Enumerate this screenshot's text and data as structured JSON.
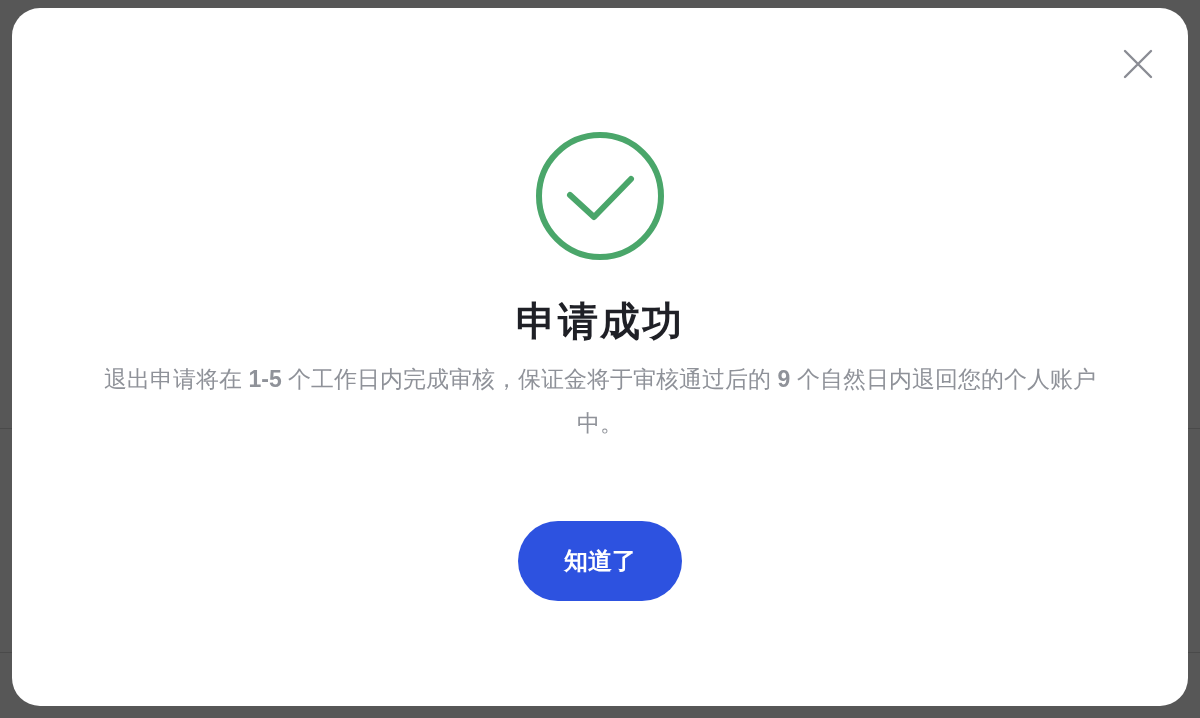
{
  "dialog": {
    "title": "申请成功",
    "message": "退出申请将在 **1-5** 个工作日内完成审核，保证金将于审核通过后的 **9** 个自然日内退回您的个人账户中。",
    "confirm_button": "知道了"
  }
}
